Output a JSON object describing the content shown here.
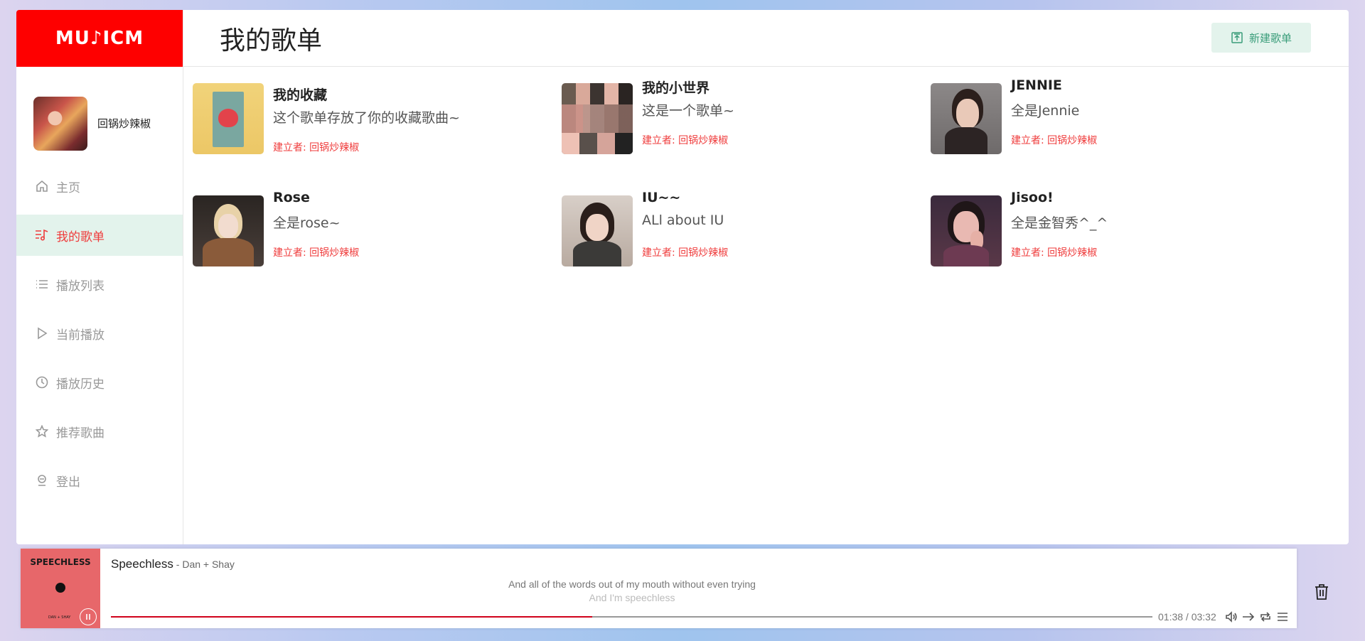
{
  "app": {
    "logo_text": "MU♪ICM"
  },
  "user": {
    "name": "回锅炒辣椒"
  },
  "nav": {
    "items": [
      {
        "label": "主页",
        "icon": "home-icon",
        "active": false
      },
      {
        "label": "我的歌单",
        "icon": "music-list-icon",
        "active": true
      },
      {
        "label": "播放列表",
        "icon": "list-icon",
        "active": false
      },
      {
        "label": "当前播放",
        "icon": "play-icon",
        "active": false
      },
      {
        "label": "播放历史",
        "icon": "clock-icon",
        "active": false
      },
      {
        "label": "推荐歌曲",
        "icon": "star-icon",
        "active": false
      },
      {
        "label": "登出",
        "icon": "logout-icon",
        "active": false
      }
    ]
  },
  "header": {
    "title": "我的歌单",
    "new_button": "新建歌单"
  },
  "playlists": [
    {
      "title": "我的收藏",
      "desc": "这个歌单存放了你的收藏歌曲~",
      "author": "建立者: 回锅炒辣椒"
    },
    {
      "title": "我的小世界",
      "desc": "这是一个歌单~",
      "author": "建立者: 回锅炒辣椒"
    },
    {
      "title": "JENNIE",
      "desc": "全是Jennie",
      "author": "建立者: 回锅炒辣椒"
    },
    {
      "title": "Rose",
      "desc": "全是rose~",
      "author": "建立者: 回锅炒辣椒"
    },
    {
      "title": "IU~~",
      "desc": "ALl about IU",
      "author": "建立者: 回锅炒辣椒"
    },
    {
      "title": "Jisoo!",
      "desc": "全是金智秀^_^",
      "author": "建立者: 回锅炒辣椒"
    }
  ],
  "player": {
    "cover_text": "SPEECHLESS",
    "cover_sub": "DAN + SHAY",
    "song": "Speechless",
    "artist": " - Dan + Shay",
    "lyric_current": "And all of the words out of my mouth without even trying",
    "lyric_next": "And I'm speechless",
    "time": "01:38 / 03:32",
    "progress": 0.462,
    "accent": "#d0021b"
  },
  "colors": {
    "brand": "#fe0000",
    "active_bg": "#e3f3ec",
    "active_text": "#ef3b3b"
  }
}
